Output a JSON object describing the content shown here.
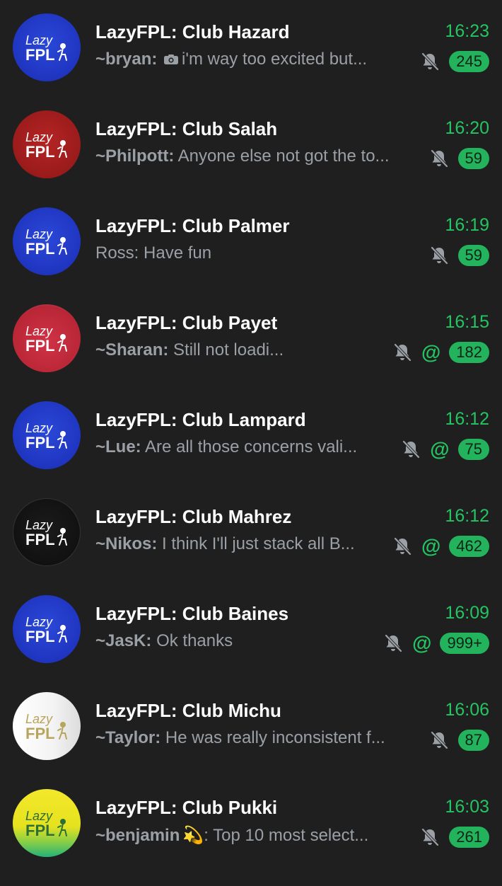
{
  "chats": [
    {
      "title": "LazyFPL: Club Hazard",
      "time": "16:23",
      "sender": "~bryan:",
      "has_camera": true,
      "message": "i'm way too excited but...",
      "muted": true,
      "mention": false,
      "unread": "245",
      "avatar_style": "blue"
    },
    {
      "title": "LazyFPL: Club Salah",
      "time": "16:20",
      "sender": "~Philpott:",
      "has_camera": false,
      "message": "Anyone else not got the to...",
      "muted": true,
      "mention": false,
      "unread": "59",
      "avatar_style": "red"
    },
    {
      "title": "LazyFPL: Club Palmer",
      "time": "16:19",
      "sender": "",
      "has_camera": false,
      "message": "Ross: Have fun",
      "muted": true,
      "mention": false,
      "unread": "59",
      "avatar_style": "blue"
    },
    {
      "title": "LazyFPL: Club Payet",
      "time": "16:15",
      "sender": "~Sharan:",
      "has_camera": false,
      "message": "Still not loadi...",
      "muted": true,
      "mention": true,
      "unread": "182",
      "avatar_style": "redlight"
    },
    {
      "title": "LazyFPL: Club Lampard",
      "time": "16:12",
      "sender": "~Lue:",
      "has_camera": false,
      "message": "Are all those concerns vali...",
      "muted": true,
      "mention": true,
      "unread": "75",
      "avatar_style": "blue"
    },
    {
      "title": "LazyFPL: Club Mahrez",
      "time": "16:12",
      "sender": "~Nikos:",
      "has_camera": false,
      "message": "I think I'll just stack all B...",
      "muted": true,
      "mention": true,
      "unread": "462",
      "avatar_style": "black"
    },
    {
      "title": "LazyFPL: Club Baines",
      "time": "16:09",
      "sender": "~JasK:",
      "has_camera": false,
      "message": "Ok thanks",
      "muted": true,
      "mention": true,
      "unread": "999+",
      "avatar_style": "blue"
    },
    {
      "title": "LazyFPL: Club Michu",
      "time": "16:06",
      "sender": "~Taylor:",
      "has_camera": false,
      "message": "He was really inconsistent f...",
      "muted": true,
      "mention": false,
      "unread": "87",
      "avatar_style": "white"
    },
    {
      "title": "LazyFPL: Club Pukki",
      "time": "16:03",
      "sender": "~benjamin",
      "has_camera": false,
      "emoji": "💫",
      "message": ": Top 10 most select...",
      "muted": true,
      "mention": false,
      "unread": "261",
      "avatar_style": "yellow"
    }
  ],
  "avatar_text": [
    "Lazy",
    "FPL"
  ],
  "mention_symbol": "@",
  "colors": {
    "background": "#1f1f1f",
    "accent_green": "#25c462",
    "badge_green": "#23b35d",
    "preview_gray": "#9aa0a6"
  }
}
